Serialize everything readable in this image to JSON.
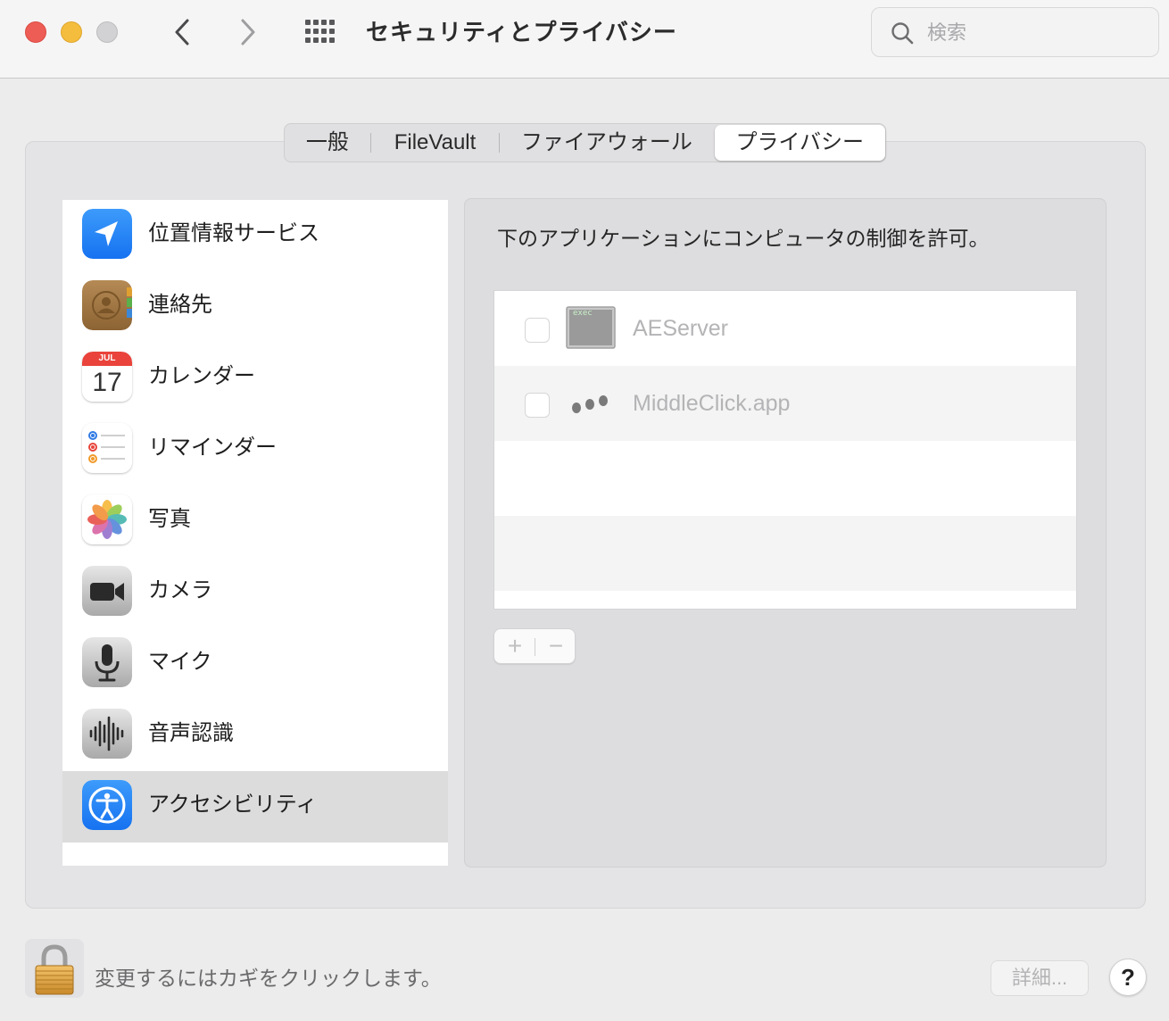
{
  "window": {
    "title": "セキュリティとプライバシー",
    "search_placeholder": "検索"
  },
  "tabs": [
    {
      "label": "一般"
    },
    {
      "label": "FileVault"
    },
    {
      "label": "ファイアウォール"
    },
    {
      "label": "プライバシー",
      "selected": true
    }
  ],
  "sidebar": {
    "items": [
      {
        "label": "位置情報サービス",
        "icon": "location-arrow-icon"
      },
      {
        "label": "連絡先",
        "icon": "contacts-icon"
      },
      {
        "label": "カレンダー",
        "icon": "calendar-icon",
        "calendar_month": "JUL",
        "calendar_day": "17"
      },
      {
        "label": "リマインダー",
        "icon": "reminders-icon"
      },
      {
        "label": "写真",
        "icon": "photos-icon"
      },
      {
        "label": "カメラ",
        "icon": "camera-icon"
      },
      {
        "label": "マイク",
        "icon": "microphone-icon"
      },
      {
        "label": "音声認識",
        "icon": "speech-recognition-icon"
      },
      {
        "label": "アクセシビリティ",
        "icon": "accessibility-icon",
        "selected": true
      }
    ]
  },
  "main": {
    "description": "下のアプリケーションにコンピュータの制御を許可。",
    "apps": [
      {
        "name": "AEServer",
        "icon": "exec-terminal-icon",
        "icon_text": "exec",
        "checked": false
      },
      {
        "name": "MiddleClick.app",
        "icon": "middleclick-dots-icon",
        "checked": false
      }
    ],
    "add_label": "+",
    "remove_label": "−"
  },
  "footer": {
    "lock_text": "変更するにはカギをクリックします。",
    "details_label": "詳細...",
    "help_label": "?"
  },
  "colors": {
    "close": "#ee5d55",
    "minimize": "#f5bd3d",
    "zoom_disabled": "#d2d1d3",
    "selected_row": "#dcdcdc"
  }
}
